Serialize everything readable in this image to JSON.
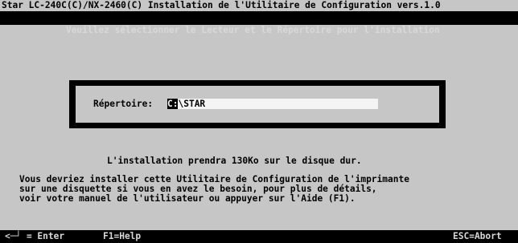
{
  "header": {
    "title": "Star LC-240C(C)/NX-2460(C) Installation de l'Utilitaire de Configuration vers.1.0",
    "instruction": "Veuillez sélectionner le Lecteur et le Répertoire pour l'installation"
  },
  "dialog": {
    "directory_label": "Répertoire:",
    "directory_value": "C:\\STAR",
    "directory_cursor_char": "C:",
    "directory_rest": "\\STAR"
  },
  "messages": {
    "space_required": "L'installation prendra 130Ko sur le disque dur.",
    "advice_line1": "Vous devriez installer cette Utilitaire de Configuration de l'imprimante",
    "advice_line2": "sur une disquette si vous en avez le besoin, pour plus de détails,",
    "advice_line3": "voir votre manuel de l'utilisateur ou appuyer sur l'Aide (F1)."
  },
  "footer": {
    "enter_key": "<─┘ = Enter",
    "help_key": "F1=Help",
    "abort_key": "ESC=Abort"
  },
  "colors": {
    "background": "#c6c6c6",
    "bar": "#000000",
    "bar_text": "#d8d8d8",
    "field": "#f4f4f4"
  }
}
